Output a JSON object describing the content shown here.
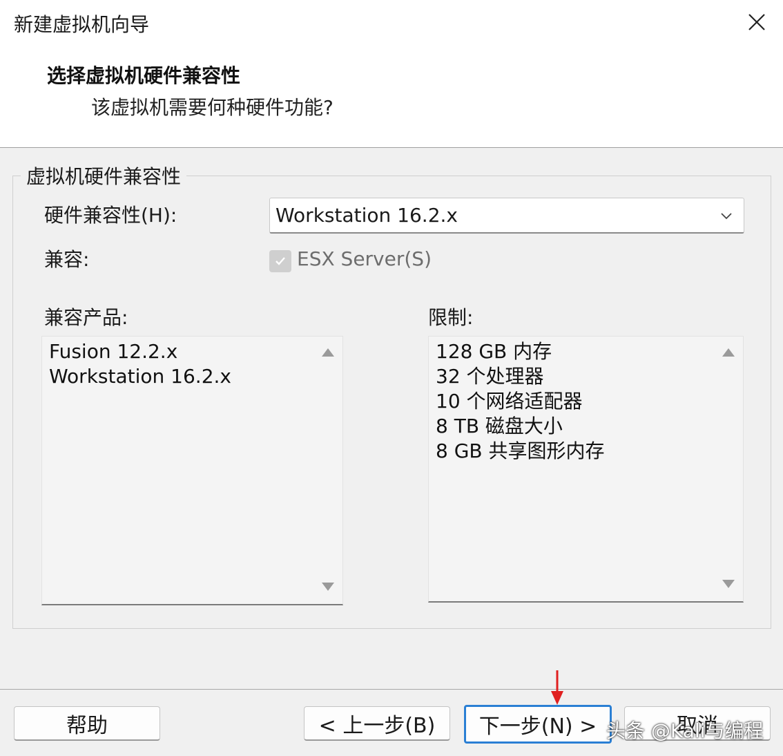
{
  "window": {
    "title": "新建虚拟机向导",
    "close_glyph": "✕"
  },
  "header": {
    "heading": "选择虚拟机硬件兼容性",
    "subheading": "该虚拟机需要何种硬件功能?"
  },
  "group": {
    "title": "虚拟机硬件兼容性",
    "hardware_label": "硬件兼容性(H):",
    "hardware_value": "Workstation 16.2.x",
    "compat_label": "兼容:",
    "esx_label": "ESX Server(S)",
    "esx_checked": true,
    "esx_enabled": false,
    "products_label": "兼容产品:",
    "products": [
      "Fusion 12.2.x",
      "Workstation 16.2.x"
    ],
    "limits_label": "限制:",
    "limits": [
      "128 GB 内存",
      "32 个处理器",
      "10 个网络适配器",
      "8 TB 磁盘大小",
      "8 GB 共享图形内存"
    ]
  },
  "footer": {
    "help": "帮助",
    "back": "< 上一步(B)",
    "next": "下一步(N) >",
    "cancel": "取消"
  },
  "watermark": "头条 @Kali与编程",
  "colors": {
    "focus_border": "#2a7fd4",
    "annotation_arrow": "#e02020"
  },
  "icons": {
    "close": "close-icon",
    "dropdown": "chevron-down-icon",
    "check": "check-icon",
    "scroll_up": "triangle-up-icon",
    "scroll_down": "triangle-down-icon",
    "annotation": "red-arrow-icon"
  }
}
